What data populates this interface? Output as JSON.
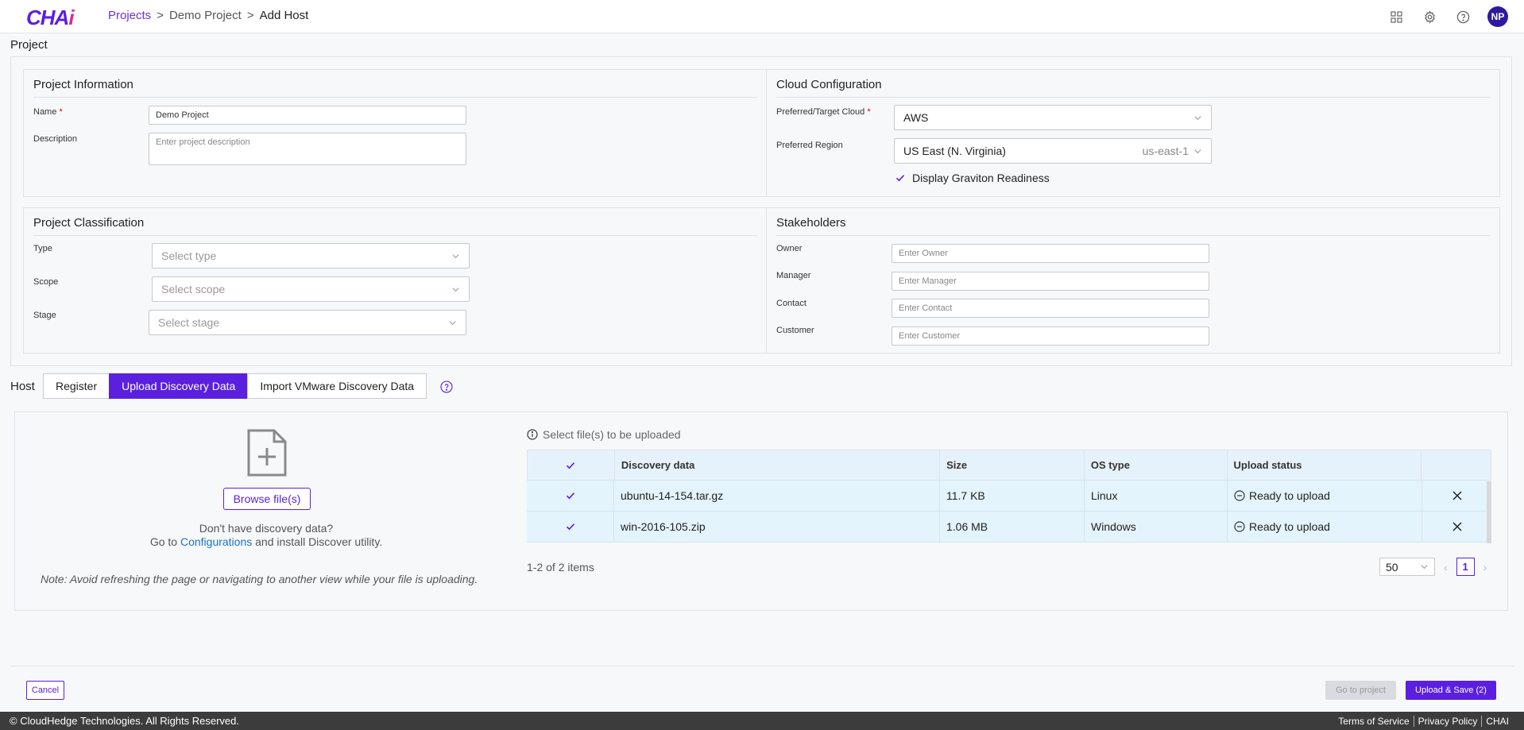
{
  "app": {
    "logo": "CHAI"
  },
  "breadcrumb": {
    "projects": "Projects",
    "project": "Demo Project",
    "current": "Add Host",
    "sep": ">"
  },
  "user": {
    "initials": "NP"
  },
  "page": {
    "title": "Project"
  },
  "project_info": {
    "title": "Project Information",
    "name_label": "Name",
    "required_mark": "*",
    "name_value": "Demo Project",
    "description_label": "Description",
    "description_placeholder": "Enter project description"
  },
  "cloud": {
    "title": "Cloud Configuration",
    "cloud_label": "Preferred/Target Cloud",
    "cloud_value": "AWS",
    "region_label": "Preferred Region",
    "region_value": "US East (N. Virginia)",
    "region_code": "us-east-1",
    "graviton_label": "Display Graviton Readiness",
    "graviton_checked": true
  },
  "classification": {
    "title": "Project Classification",
    "type_label": "Type",
    "type_placeholder": "Select type",
    "scope_label": "Scope",
    "scope_placeholder": "Select scope",
    "stage_label": "Stage",
    "stage_placeholder": "Select stage"
  },
  "stakeholders": {
    "title": "Stakeholders",
    "owner_label": "Owner",
    "owner_placeholder": "Enter Owner",
    "manager_label": "Manager",
    "manager_placeholder": "Enter Manager",
    "contact_label": "Contact",
    "contact_placeholder": "Enter Contact",
    "customer_label": "Customer",
    "customer_placeholder": "Enter Customer"
  },
  "host": {
    "label": "Host",
    "tabs": [
      "Register",
      "Upload Discovery Data",
      "Import VMware Discovery Data"
    ],
    "active_tab": 1
  },
  "upload": {
    "browse_label": "Browse file(s)",
    "no_data_line1": "Don't have discovery data?",
    "no_data_go_to": "Go to",
    "no_data_link": "Configurations",
    "no_data_rest": "and install Discover utility.",
    "note": "Note: Avoid refreshing the page or navigating to another view while your file is uploading.",
    "hint": "Select file(s) to be uploaded",
    "columns": [
      "Discovery data",
      "Size",
      "OS type",
      "Upload status"
    ],
    "rows": [
      {
        "name": "ubuntu-14-154.tar.gz",
        "size": "11.7 KB",
        "os": "Linux",
        "status": "Ready to upload"
      },
      {
        "name": "win-2016-105.zip",
        "size": "1.06 MB",
        "os": "Windows",
        "status": "Ready to upload"
      }
    ],
    "items_count": "1-2 of 2 items",
    "page_size": "50",
    "current_page": "1"
  },
  "actions": {
    "cancel": "Cancel",
    "go_to_project": "Go to project",
    "upload_save": "Upload & Save (2)"
  },
  "footer": {
    "copyright": "© CloudHedge Technologies. All Rights Reserved.",
    "links": [
      "Terms of Service",
      "Privacy Policy",
      "CHAI"
    ]
  },
  "colors": {
    "accent": "#5b1fe0",
    "link": "#1a73c9",
    "row_bg": "#e3f4fc"
  }
}
